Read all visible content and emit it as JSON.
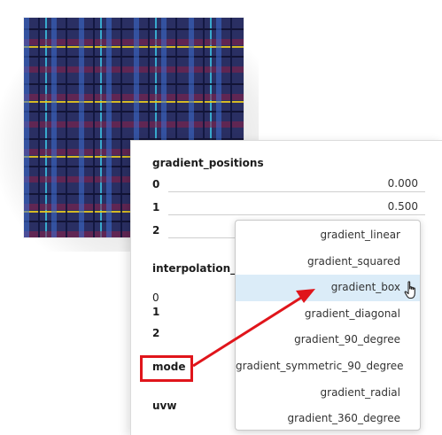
{
  "panel": {
    "gradient_positions_label": "gradient_positions",
    "rows": [
      {
        "index": "0",
        "value": "0.000"
      },
      {
        "index": "1",
        "value": "0.500"
      },
      {
        "index": "2",
        "value": ""
      }
    ],
    "interpolation_label": "interpolation_mo",
    "interp_rows": [
      "0",
      "1",
      "2"
    ],
    "mode_label": "mode",
    "uvw_label": "uvw"
  },
  "dropdown": {
    "options": [
      "gradient_linear",
      "gradient_squared",
      "gradient_box",
      "gradient_diagonal",
      "gradient_90_degree",
      "gradient_symmetric_90_degree",
      "gradient_radial",
      "gradient_360_degree"
    ],
    "selected": "gradient_box"
  },
  "colors": {
    "highlight": "#e0151b",
    "selected_bg": "#dbecf8"
  },
  "icons": {
    "cursor": "hand-pointer-icon",
    "arrow": "annotation-arrow-icon"
  }
}
